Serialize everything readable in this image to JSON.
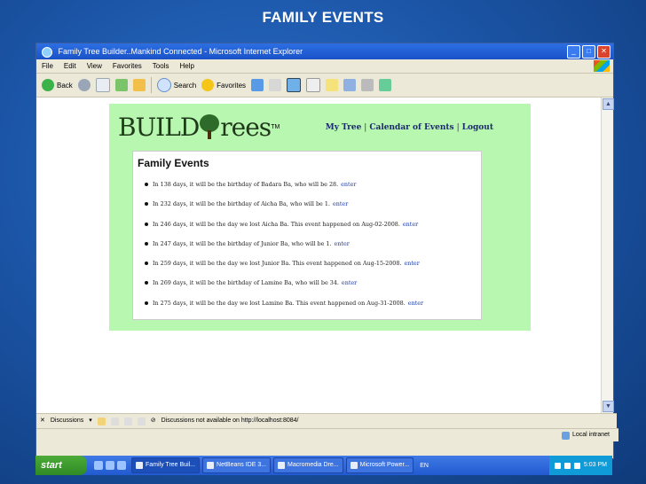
{
  "slide": {
    "title": "FAMILY EVENTS"
  },
  "window": {
    "title": "Family Tree Builder..Mankind Connected - Microsoft Internet Explorer",
    "menu": [
      "File",
      "Edit",
      "View",
      "Favorites",
      "Tools",
      "Help"
    ],
    "toolbar": {
      "back_label": "Back",
      "search_label": "Search",
      "favorites_label": "Favorites"
    }
  },
  "page": {
    "logo": {
      "part1": "BUILD",
      "part2": "rees",
      "tm": "TM"
    },
    "nav": {
      "my_tree": "My Tree",
      "separator": "|",
      "calendar": "Calendar of Events",
      "logout": "Logout"
    },
    "events_title": "Family Events",
    "events": [
      {
        "text": "In 138 days, it will be the birthday of Badara Ba, who will be 28.",
        "link": "enter"
      },
      {
        "text": "In 232 days, it will be the birthday of Aicha Ba, who will be 1.",
        "link": "enter"
      },
      {
        "text": "In 246 days, it will be the day we lost Aicha Ba. This event happened on Aug-02-2008.",
        "link": "enter"
      },
      {
        "text": "In 247 days, it will be the birthday of Junior Ba, who will be 1.",
        "link": "enter"
      },
      {
        "text": "In 259 days, it will be the day we lost Junior Ba. This event happened on Aug-15-2008.",
        "link": "enter"
      },
      {
        "text": "In 269 days, it will be the birthday of Lamine Ba, who will be 34.",
        "link": "enter"
      },
      {
        "text": "In 275 days, it will be the day we lost Lamine Ba. This event happened on Aug-31-2008.",
        "link": "enter"
      }
    ]
  },
  "discussions": {
    "label": "Discussions",
    "message": "Discussions not available on http://localhost:8084/"
  },
  "status": {
    "zone": "Local intranet"
  },
  "taskbar": {
    "start_label": "start",
    "tasks": [
      "Family Tree Buil...",
      "NetBeans IDE 3...",
      "Macromedia Dre...",
      "Microsoft Power..."
    ],
    "lang": "EN",
    "clock": "5:03 PM"
  }
}
